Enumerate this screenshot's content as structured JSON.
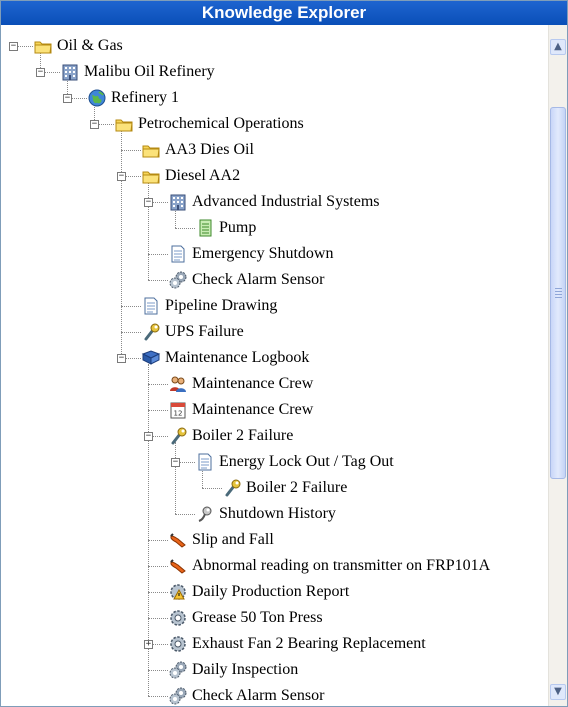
{
  "title": "Knowledge Explorer",
  "tree": [
    {
      "label": "Oil & Gas",
      "icon": "folder-icon",
      "level": 0,
      "expander": "minus"
    },
    {
      "label": "Malibu Oil Refinery",
      "icon": "building-icon",
      "level": 1,
      "expander": "minus"
    },
    {
      "label": "Refinery 1",
      "icon": "globe-icon",
      "level": 2,
      "expander": "minus"
    },
    {
      "label": "Petrochemical Operations",
      "icon": "folder-icon",
      "level": 3,
      "expander": "minus"
    },
    {
      "label": "AA3 Dies Oil",
      "icon": "folder-icon",
      "level": 4,
      "expander": "none"
    },
    {
      "label": "Diesel AA2",
      "icon": "folder-icon",
      "level": 4,
      "expander": "minus"
    },
    {
      "label": "Advanced Industrial Systems",
      "icon": "building-icon",
      "level": 5,
      "expander": "minus"
    },
    {
      "label": "Pump",
      "icon": "equipment-icon",
      "level": 6,
      "expander": "none"
    },
    {
      "label": "Emergency Shutdown",
      "icon": "document-icon",
      "level": 5,
      "expander": "none"
    },
    {
      "label": "Check Alarm Sensor",
      "icon": "gears-icon",
      "level": 5,
      "expander": "none"
    },
    {
      "label": "Pipeline Drawing",
      "icon": "document-icon",
      "level": 4,
      "expander": "none"
    },
    {
      "label": "UPS Failure",
      "icon": "wrench-icon",
      "level": 4,
      "expander": "none"
    },
    {
      "label": "Maintenance Logbook",
      "icon": "book-icon",
      "level": 4,
      "expander": "minus"
    },
    {
      "label": "Maintenance Crew",
      "icon": "people-icon",
      "level": 5,
      "expander": "none"
    },
    {
      "label": "Maintenance Crew",
      "icon": "calendar-icon",
      "level": 5,
      "expander": "none"
    },
    {
      "label": "Boiler 2 Failure",
      "icon": "wrench-icon",
      "level": 5,
      "expander": "minus"
    },
    {
      "label": "Energy Lock Out / Tag Out",
      "icon": "document-icon",
      "level": 6,
      "expander": "minus"
    },
    {
      "label": "Boiler 2 Failure",
      "icon": "wrench-icon",
      "level": 7,
      "expander": "none"
    },
    {
      "label": "Shutdown History",
      "icon": "history-icon",
      "level": 6,
      "expander": "none"
    },
    {
      "label": "Slip and Fall",
      "icon": "incident-icon",
      "level": 5,
      "expander": "none"
    },
    {
      "label": "Abnormal reading on transmitter on FRP101A",
      "icon": "incident-icon",
      "level": 5,
      "expander": "none"
    },
    {
      "label": "Daily Production Report",
      "icon": "gear-warning-icon",
      "level": 5,
      "expander": "none"
    },
    {
      "label": "Grease 50 Ton Press",
      "icon": "gear-icon",
      "level": 5,
      "expander": "none"
    },
    {
      "label": "Exhaust Fan 2 Bearing Replacement",
      "icon": "gear-icon",
      "level": 5,
      "expander": "plus"
    },
    {
      "label": "Daily Inspection",
      "icon": "gears-icon",
      "level": 5,
      "expander": "none"
    },
    {
      "label": "Check Alarm Sensor",
      "icon": "gears-icon",
      "level": 5,
      "expander": "none"
    }
  ]
}
